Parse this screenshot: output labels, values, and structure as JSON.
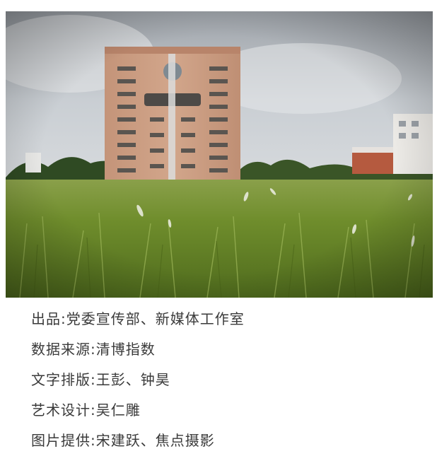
{
  "photo": {
    "subject": "campus building behind a grass lawn"
  },
  "credits": [
    {
      "label": "出品",
      "separator": ":",
      "value": "党委宣传部、新媒体工作室"
    },
    {
      "label": "数据来源",
      "separator": ":",
      "value": "清博指数"
    },
    {
      "label": "文字排版",
      "separator": ":",
      "value": "王彭、钟昊"
    },
    {
      "label": "艺术设计",
      "separator": ":",
      "value": "吴仁雕"
    },
    {
      "label": "图片提供",
      "separator": ":",
      "value": "宋建跃、焦点摄影"
    }
  ],
  "colors": {
    "text": "#3a3a3a",
    "sky": "#c9cdd2",
    "building": "#c99a7f",
    "grass": "#6f8f2e"
  }
}
